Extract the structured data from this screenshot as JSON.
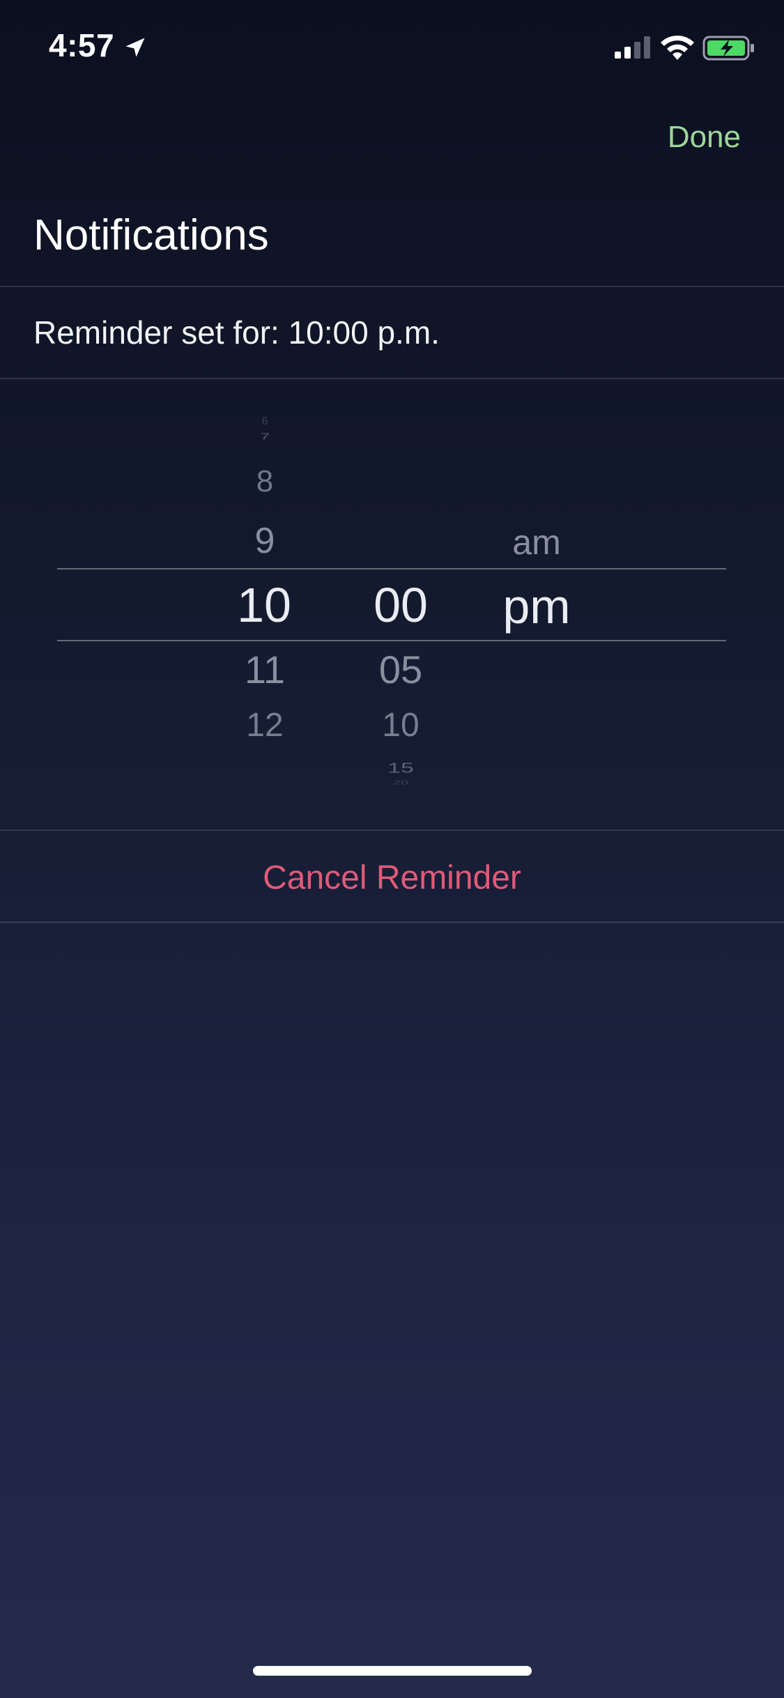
{
  "status_bar": {
    "time": "4:57",
    "icons": [
      "location-arrow-icon",
      "cellular-signal-icon",
      "wifi-icon",
      "battery-charging-icon"
    ],
    "battery_color": "#4cd964"
  },
  "header": {
    "done_label": "Done",
    "title": "Notifications"
  },
  "reminder": {
    "label": "Reminder set for: 10:00 p.m."
  },
  "picker": {
    "hours": {
      "above": [
        "6",
        "7",
        "8",
        "9"
      ],
      "selected": "10",
      "below": [
        "11",
        "12"
      ]
    },
    "minutes": {
      "selected": "00",
      "below": [
        "05",
        "10",
        "15",
        "20"
      ]
    },
    "period": {
      "above": [
        "am"
      ],
      "selected": "pm"
    }
  },
  "actions": {
    "cancel_label": "Cancel Reminder"
  },
  "colors": {
    "accent_done": "#9fd69a",
    "destructive": "#e05a78",
    "background_top": "#0b1020",
    "background_bottom": "#242a4b"
  }
}
